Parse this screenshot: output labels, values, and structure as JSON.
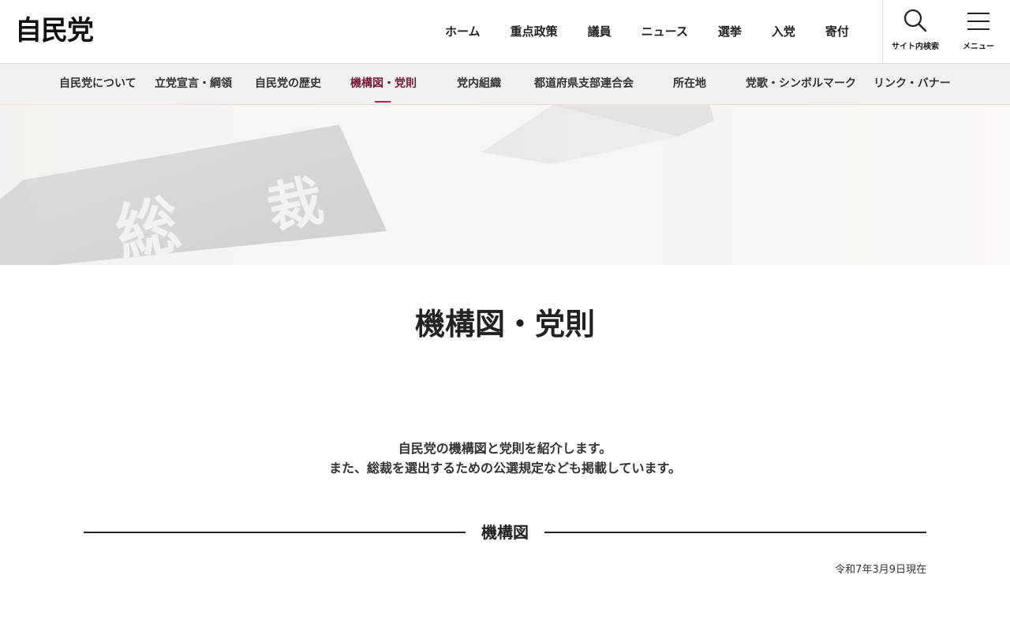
{
  "header": {
    "logo": "自民党",
    "nav": [
      "ホーム",
      "重点政策",
      "議員",
      "ニュース",
      "選挙",
      "入党",
      "寄付"
    ],
    "search_label": "サイト内検索",
    "menu_label": "メニュー"
  },
  "subnav": {
    "items": [
      "自民党について",
      "立党宣言・綱領",
      "自民党の歴史",
      "機構図・党則",
      "党内組織",
      "都道府県支部連合会",
      "所在地",
      "党歌・シンボルマーク",
      "リンク・バナー"
    ],
    "active": "機構図・党則"
  },
  "hero": {
    "sign_text_1": "総",
    "sign_text_2": "裁"
  },
  "main": {
    "title": "機構図・党則",
    "intro_line1": "自民党の機構図と党則を紹介します。",
    "intro_line2": "また、総裁を選出するための公選規定なども掲載しています。",
    "section_title": "機構図",
    "as_of": "令和7年3月9日現在"
  },
  "colors": {
    "accent": "#c8174a",
    "active_text": "#7a1a3a"
  }
}
